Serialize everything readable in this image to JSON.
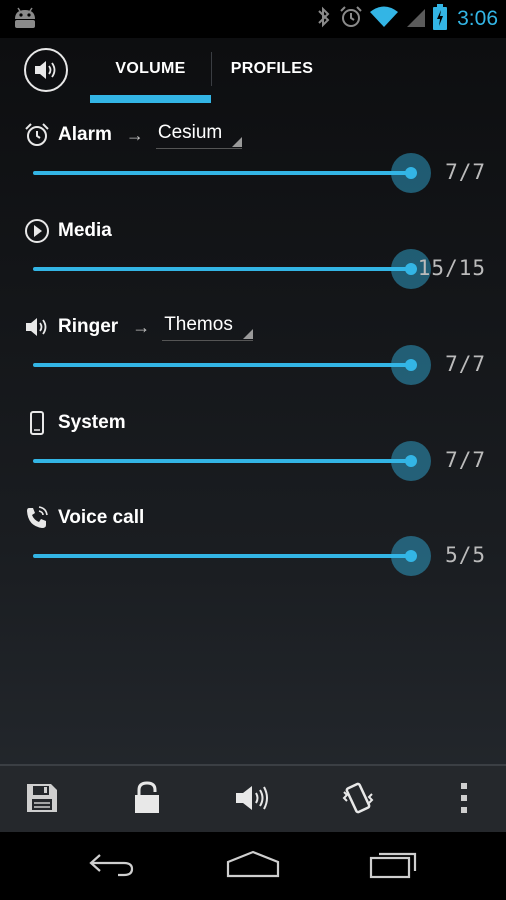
{
  "status": {
    "time": "3:06",
    "icons": [
      "android-icon",
      "bluetooth-icon",
      "alarm-icon",
      "wifi-icon",
      "signal-icon",
      "battery-charging-icon"
    ],
    "accent": "#33b5e5"
  },
  "tabs": [
    {
      "label": "VOLUME",
      "active": true
    },
    {
      "label": "PROFILES",
      "active": false
    }
  ],
  "streams": [
    {
      "label": "Alarm",
      "icon": "alarm-clock-icon",
      "tone": "Cesium",
      "level": 7,
      "max": 7,
      "value_text": "7/7"
    },
    {
      "label": "Media",
      "icon": "play-icon",
      "level": 15,
      "max": 15,
      "value_text": "15/15"
    },
    {
      "label": "Ringer",
      "icon": "speaker-icon",
      "tone": "Themos",
      "level": 7,
      "max": 7,
      "value_text": "7/7"
    },
    {
      "label": "System",
      "icon": "phone-icon",
      "level": 7,
      "max": 7,
      "value_text": "7/7"
    },
    {
      "label": "Voice call",
      "icon": "voice-call-icon",
      "level": 5,
      "max": 5,
      "value_text": "5/5"
    }
  ],
  "actions": [
    "save-icon",
    "lock-icon",
    "speaker-icon",
    "vibrate-icon",
    "overflow-menu-icon"
  ],
  "nav": [
    "back-icon",
    "home-icon",
    "recents-icon"
  ]
}
